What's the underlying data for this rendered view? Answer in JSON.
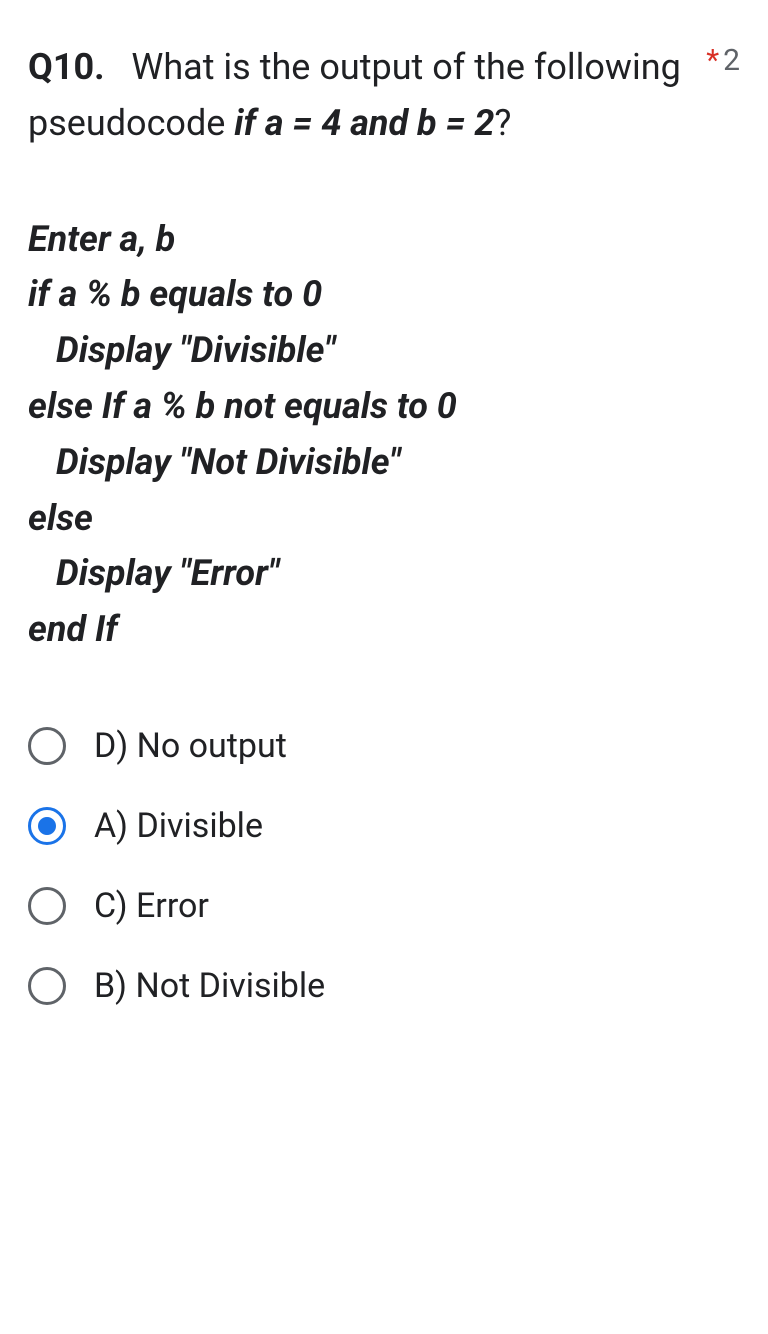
{
  "question": {
    "number": "Q10.",
    "prompt_part1": "What is the output of the following pseudocode ",
    "prompt_bold": "if a = 4 and b = 2",
    "prompt_part2": "?",
    "required_marker": "*",
    "points": "2"
  },
  "pseudocode": {
    "l1": "Enter a, b",
    "l2": "if a % b equals to 0",
    "l3": "Display \"Divisible\"",
    "l4": "else If a % b not equals to 0",
    "l5": "Display \"Not Divisible\"",
    "l6": "else",
    "l7": "Display \"Error\"",
    "l8": "end If"
  },
  "options": [
    {
      "label": "D) No output",
      "selected": false
    },
    {
      "label": "A) Divisible",
      "selected": true
    },
    {
      "label": "C) Error",
      "selected": false
    },
    {
      "label": "B) Not Divisible",
      "selected": false
    }
  ]
}
